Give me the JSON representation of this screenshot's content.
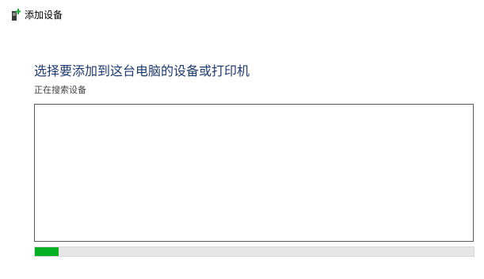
{
  "window": {
    "title": "添加设备",
    "icon": "add-device-icon"
  },
  "main": {
    "heading": "选择要添加到这台电脑的设备或打印机",
    "status": "正在搜索设备"
  },
  "device_list": {
    "items": []
  },
  "progress": {
    "fraction": 0.055
  },
  "colors": {
    "heading": "#1f3a6e",
    "progress_fill": "#06b025",
    "progress_track": "#e6e6e6"
  }
}
